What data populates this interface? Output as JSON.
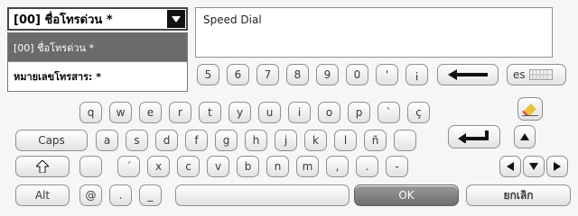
{
  "dropdown": {
    "selected": "[00] ชื่อโทรด่วน *",
    "options": [
      "[00] ชื่อโทรด่วน *",
      "หมายเลขโทรสาร: *"
    ]
  },
  "text_field": {
    "value": "Speed Dial"
  },
  "keyboard": {
    "row1": {
      "keys": [
        "5",
        "6",
        "7",
        "8",
        "9",
        "0",
        "'",
        "¡"
      ],
      "lang_label": "es"
    },
    "row2": {
      "keys": [
        "q",
        "w",
        "e",
        "r",
        "t",
        "y",
        "u",
        "i",
        "o",
        "p",
        "`",
        "ç"
      ]
    },
    "row3": {
      "caps_label": "Caps",
      "keys": [
        "a",
        "s",
        "d",
        "f",
        "g",
        "h",
        "j",
        "k",
        "l",
        "ñ",
        ""
      ]
    },
    "row4": {
      "keys": [
        "",
        "´",
        "x",
        "c",
        "v",
        "b",
        "n",
        "m",
        ",",
        ".",
        "-"
      ]
    },
    "row5": {
      "alt_label": "Alt",
      "keys": [
        "@",
        ".",
        "_"
      ],
      "ok_label": "OK",
      "cancel_label": "ยกเลิก"
    }
  },
  "icons": {
    "backspace": "left-arrow-icon",
    "enter": "enter-arrow-icon",
    "shift": "shift-icon",
    "eraser": "eraser-icon",
    "keyboard": "keyboard-icon"
  }
}
